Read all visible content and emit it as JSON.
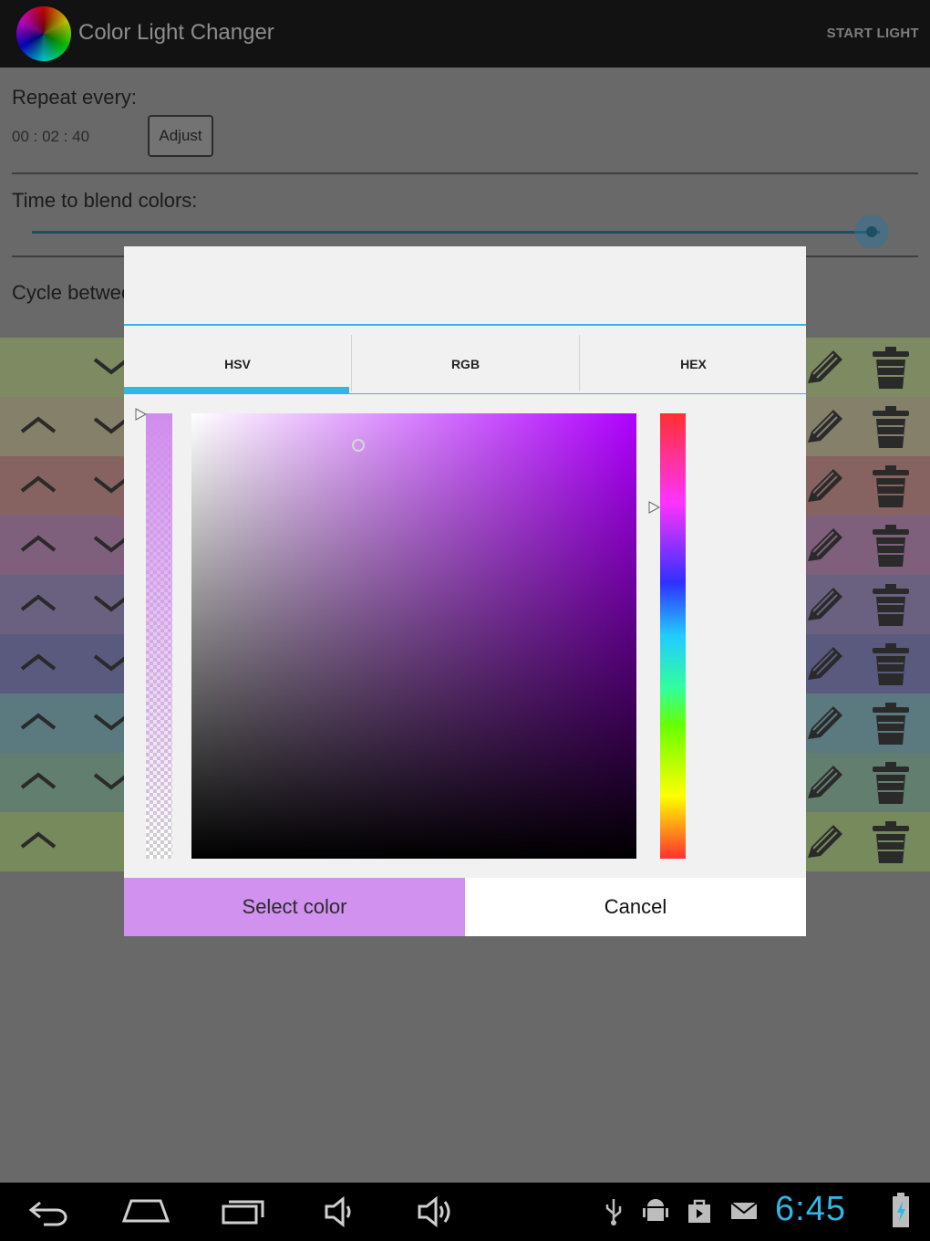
{
  "app": {
    "title": "Color Light Changer",
    "action": "START LIGHT",
    "icon": "color-wheel-icon"
  },
  "settings": {
    "repeat_label": "Repeat every:",
    "repeat_time": "00 : 02 : 40",
    "adjust_label": "Adjust",
    "blend_label": "Time to blend colors:",
    "blend_slider_value": 0.99,
    "cycle_label": "Cycle between"
  },
  "color_rows": [
    {
      "color": "#7d8a62",
      "up": false,
      "down": true
    },
    {
      "color": "#85806a",
      "up": true,
      "down": true
    },
    {
      "color": "#866260",
      "up": true,
      "down": true
    },
    {
      "color": "#7e607c",
      "up": true,
      "down": true
    },
    {
      "color": "#6a6180",
      "up": true,
      "down": true
    },
    {
      "color": "#5a5a7e",
      "up": true,
      "down": true
    },
    {
      "color": "#5a7a80",
      "up": true,
      "down": true
    },
    {
      "color": "#627e6e",
      "up": true,
      "down": true
    },
    {
      "color": "#768a5c",
      "up": true,
      "down": false
    }
  ],
  "dialog": {
    "tabs": [
      "HSV",
      "RGB",
      "HEX"
    ],
    "active_tab": 0,
    "selected_color": "#d092ee",
    "hue_color": "#b000ff",
    "select_label": "Select color",
    "cancel_label": "Cancel"
  },
  "status_bar": {
    "clock": "6:45",
    "accent": "#33b5e5",
    "nav_icons": [
      "back-icon",
      "home-icon",
      "recent-apps-icon",
      "volume-down-icon",
      "volume-up-icon"
    ],
    "status_icons": [
      "usb-icon",
      "android-debug-icon",
      "store-icon",
      "email-icon",
      "battery-charging-icon"
    ]
  }
}
